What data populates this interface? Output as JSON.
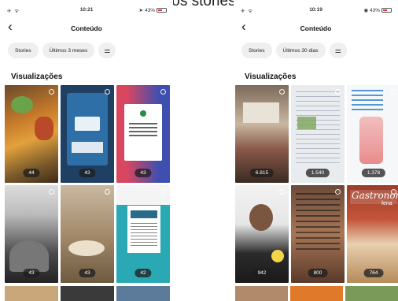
{
  "caption": "atingidas nos stories",
  "left": {
    "status": {
      "time": "10:21",
      "battery": "43%"
    },
    "header": {
      "back": "‹",
      "title": "Conteúdo"
    },
    "chips": [
      "Stories",
      "Últimos 3 meses"
    ],
    "filter_icon": "sliders-icon",
    "section": "Visualizações",
    "tiles": [
      {
        "count": "44"
      },
      {
        "count": "43"
      },
      {
        "count": "43"
      },
      {
        "count": "43"
      },
      {
        "count": "43"
      },
      {
        "count": "42"
      }
    ]
  },
  "right": {
    "status": {
      "time": "10:19",
      "battery": "43%"
    },
    "header": {
      "back": "‹",
      "title": "Conteúdo"
    },
    "chips": [
      "Stories",
      "Últimos 30 dias"
    ],
    "filter_icon": "sliders-icon",
    "section": "Visualizações",
    "tiles": [
      {
        "count": "6.815"
      },
      {
        "count": "1.540"
      },
      {
        "count": "1.378"
      },
      {
        "count": "942"
      },
      {
        "count": "800"
      },
      {
        "count": "764"
      }
    ],
    "gastro_title": "Gastronom",
    "gastro_sub": "fena"
  },
  "colors": {
    "chip_bg": "#efefef",
    "accent_red": "#d9465f",
    "accent_blue": "#3e4fb0",
    "teal": "#2aa9b5"
  }
}
